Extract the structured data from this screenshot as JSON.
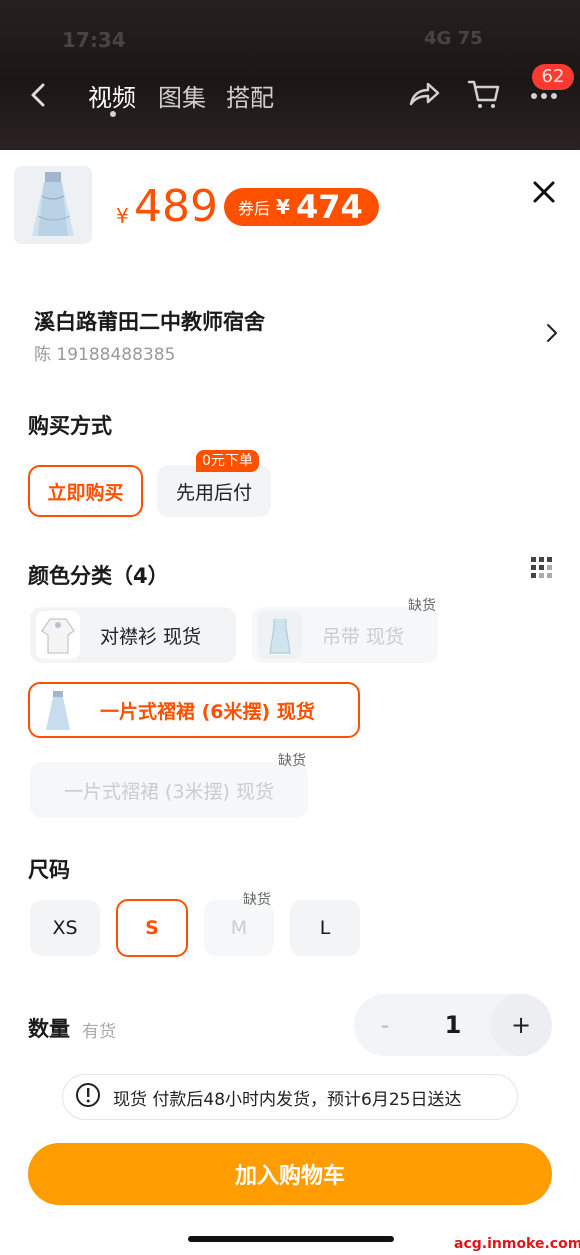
{
  "status": {
    "time": "17:34",
    "right": "4G 75"
  },
  "nav": {
    "tabs": [
      "视频",
      "图集",
      "搭配"
    ],
    "active_tab": "视频",
    "cart_badge": "62"
  },
  "product": {
    "price_symbol": "¥",
    "price": "489",
    "coupon_label": "券后",
    "coupon_symbol": "¥",
    "coupon_price": "474"
  },
  "address": {
    "name": "溪白路莆田二中教师宿舍",
    "phone": "陈 19188488385"
  },
  "purchase": {
    "title": "购买方式",
    "options": [
      "立即购买",
      "先用后付"
    ],
    "selected": "立即购买",
    "tag": "0元下单"
  },
  "color": {
    "title": "颜色分类（4）",
    "options": [
      {
        "label": "对襟衫  现货",
        "state": "normal"
      },
      {
        "label": "吊带  现货",
        "state": "disabled",
        "stock": "缺货"
      },
      {
        "label": "一片式褶裙 (6米摆)  现货",
        "state": "selected"
      },
      {
        "label": "一片式褶裙 (3米摆)  现货",
        "state": "disabled",
        "stock": "缺货"
      }
    ]
  },
  "size": {
    "title": "尺码",
    "options": [
      "XS",
      "S",
      "M",
      "L"
    ],
    "selected": "S",
    "disabled": "M",
    "stock_out": "缺货"
  },
  "quantity": {
    "title": "数量",
    "stock": "有货",
    "minus": "-",
    "value": "1",
    "plus": "+"
  },
  "notice": {
    "text": "现货 付款后48小时内发货，预计6月25日送达"
  },
  "cta": {
    "label": "加入购物车"
  },
  "watermark": "acg.inmoke.com",
  "colors": {
    "accent": "#ff5000",
    "cta": "#ff9c00",
    "badge": "#ff3b2f"
  }
}
